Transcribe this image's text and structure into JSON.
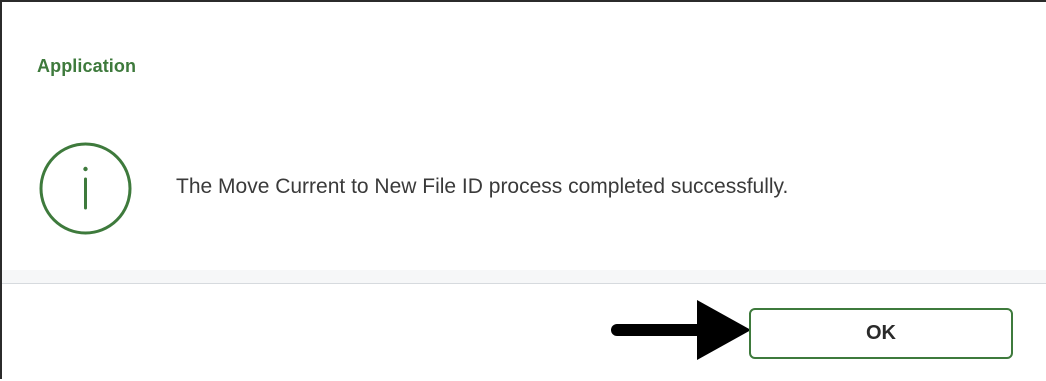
{
  "dialog": {
    "title": "Application",
    "message": "The Move Current to New File ID process completed successfully.",
    "icon": "info-icon",
    "ok_label": "OK",
    "pointer": "arrow-pointer-icon"
  },
  "colors": {
    "accent_green": "#3e7a3c",
    "text": "#3a3a3a",
    "border": "#2b2b2b"
  }
}
